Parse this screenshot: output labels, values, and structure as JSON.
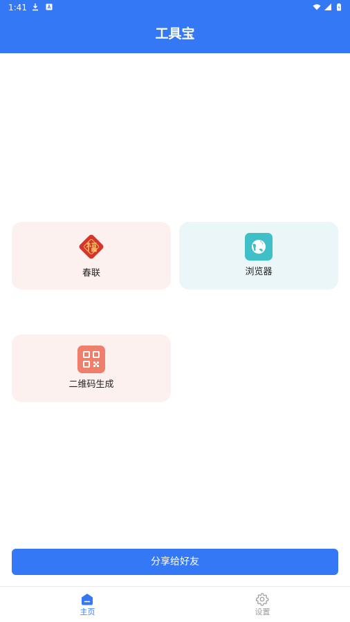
{
  "status_bar": {
    "time": "1:41",
    "icons": [
      "download-icon",
      "a-icon",
      "wifi-icon",
      "signal-icon",
      "battery-icon"
    ]
  },
  "header": {
    "title": "工具宝",
    "background": "#3578f6"
  },
  "tools": [
    {
      "label": "春联",
      "icon": "fu-diamond-icon",
      "card_color": "#fdf1ef",
      "icon_color": "#d5352d"
    },
    {
      "label": "浏览器",
      "icon": "globe-icon",
      "card_color": "#eaf6f8",
      "icon_color": "#3fbfc8"
    },
    {
      "label": "二维码生成",
      "icon": "qr-code-icon",
      "card_color": "#fdf1ef",
      "icon_color": "#ef7f6a"
    }
  ],
  "share_button": {
    "label": "分享给好友",
    "color": "#3578f6"
  },
  "bottom_nav": {
    "items": [
      {
        "label": "主页",
        "icon": "home-icon",
        "active": true,
        "color": "#3578f6"
      },
      {
        "label": "设置",
        "icon": "gear-icon",
        "active": false,
        "color": "#9a9a9a"
      }
    ]
  }
}
